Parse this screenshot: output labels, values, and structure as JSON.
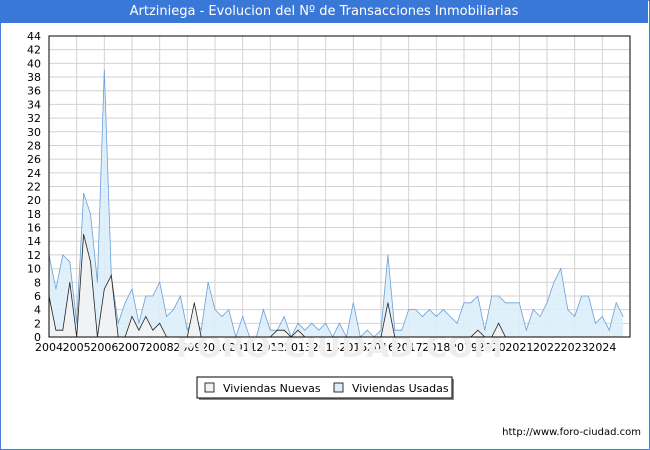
{
  "chart_data": {
    "type": "area",
    "title": "Artziniega - Evolucion del Nº de Transacciones Inmobiliarias",
    "xlabel": "",
    "ylabel": "",
    "ylim": [
      0,
      44
    ],
    "yticks": [
      0,
      2,
      4,
      6,
      8,
      10,
      12,
      14,
      16,
      18,
      20,
      22,
      24,
      26,
      28,
      30,
      32,
      34,
      36,
      38,
      40,
      42,
      44
    ],
    "xticks": [
      "2004",
      "2005",
      "2006",
      "2007",
      "2008",
      "2009",
      "2010",
      "2011",
      "2012",
      "2013",
      "2014",
      "2015",
      "2016",
      "2017",
      "2018",
      "2019",
      "2020",
      "2021",
      "2022",
      "2023",
      "2024"
    ],
    "x_start_year": 2004,
    "points_per_year": 4,
    "grid": true,
    "legend_position": "bottom",
    "series": [
      {
        "name": "Viviendas Usadas",
        "color": "#6a9fd8",
        "fill": "#ddeefa",
        "values": [
          12,
          7,
          12,
          11,
          2,
          21,
          18,
          8,
          39,
          9,
          2,
          5,
          7,
          2,
          6,
          6,
          8,
          3,
          4,
          6,
          1,
          3,
          1,
          8,
          4,
          3,
          4,
          0,
          3,
          0,
          0,
          4,
          1,
          1,
          3,
          0,
          2,
          1,
          2,
          1,
          2,
          0,
          2,
          0,
          5,
          0,
          1,
          0,
          1,
          12,
          1,
          1,
          4,
          4,
          3,
          4,
          3,
          4,
          3,
          2,
          5,
          5,
          6,
          1,
          6,
          6,
          5,
          5,
          5,
          1,
          4,
          3,
          5,
          8,
          10,
          4,
          3,
          6,
          6,
          2,
          3,
          1,
          5,
          3
        ]
      },
      {
        "name": "Viviendas Nuevas",
        "color": "#222222",
        "fill": "#f2f2f2",
        "values": [
          6,
          1,
          1,
          8,
          0,
          15,
          11,
          0,
          7,
          9,
          0,
          0,
          3,
          1,
          3,
          1,
          2,
          0,
          0,
          0,
          0,
          5,
          0,
          0,
          0,
          0,
          0,
          0,
          0,
          0,
          0,
          0,
          0,
          1,
          1,
          0,
          1,
          0,
          0,
          0,
          0,
          0,
          0,
          0,
          0,
          0,
          0,
          0,
          0,
          5,
          0,
          0,
          0,
          0,
          0,
          0,
          0,
          0,
          0,
          0,
          0,
          0,
          1,
          0,
          0,
          2,
          0,
          0,
          0,
          0,
          0,
          0,
          0,
          0,
          0,
          0,
          0,
          0,
          0,
          0,
          0,
          0,
          0,
          0
        ]
      }
    ]
  },
  "legend": {
    "items": [
      {
        "label": "Viviendas Nuevas"
      },
      {
        "label": "Viviendas Usadas"
      }
    ]
  },
  "footer": {
    "source": "http://www.foro-ciudad.com"
  },
  "watermark": "FORO-CIUDAD.COM"
}
